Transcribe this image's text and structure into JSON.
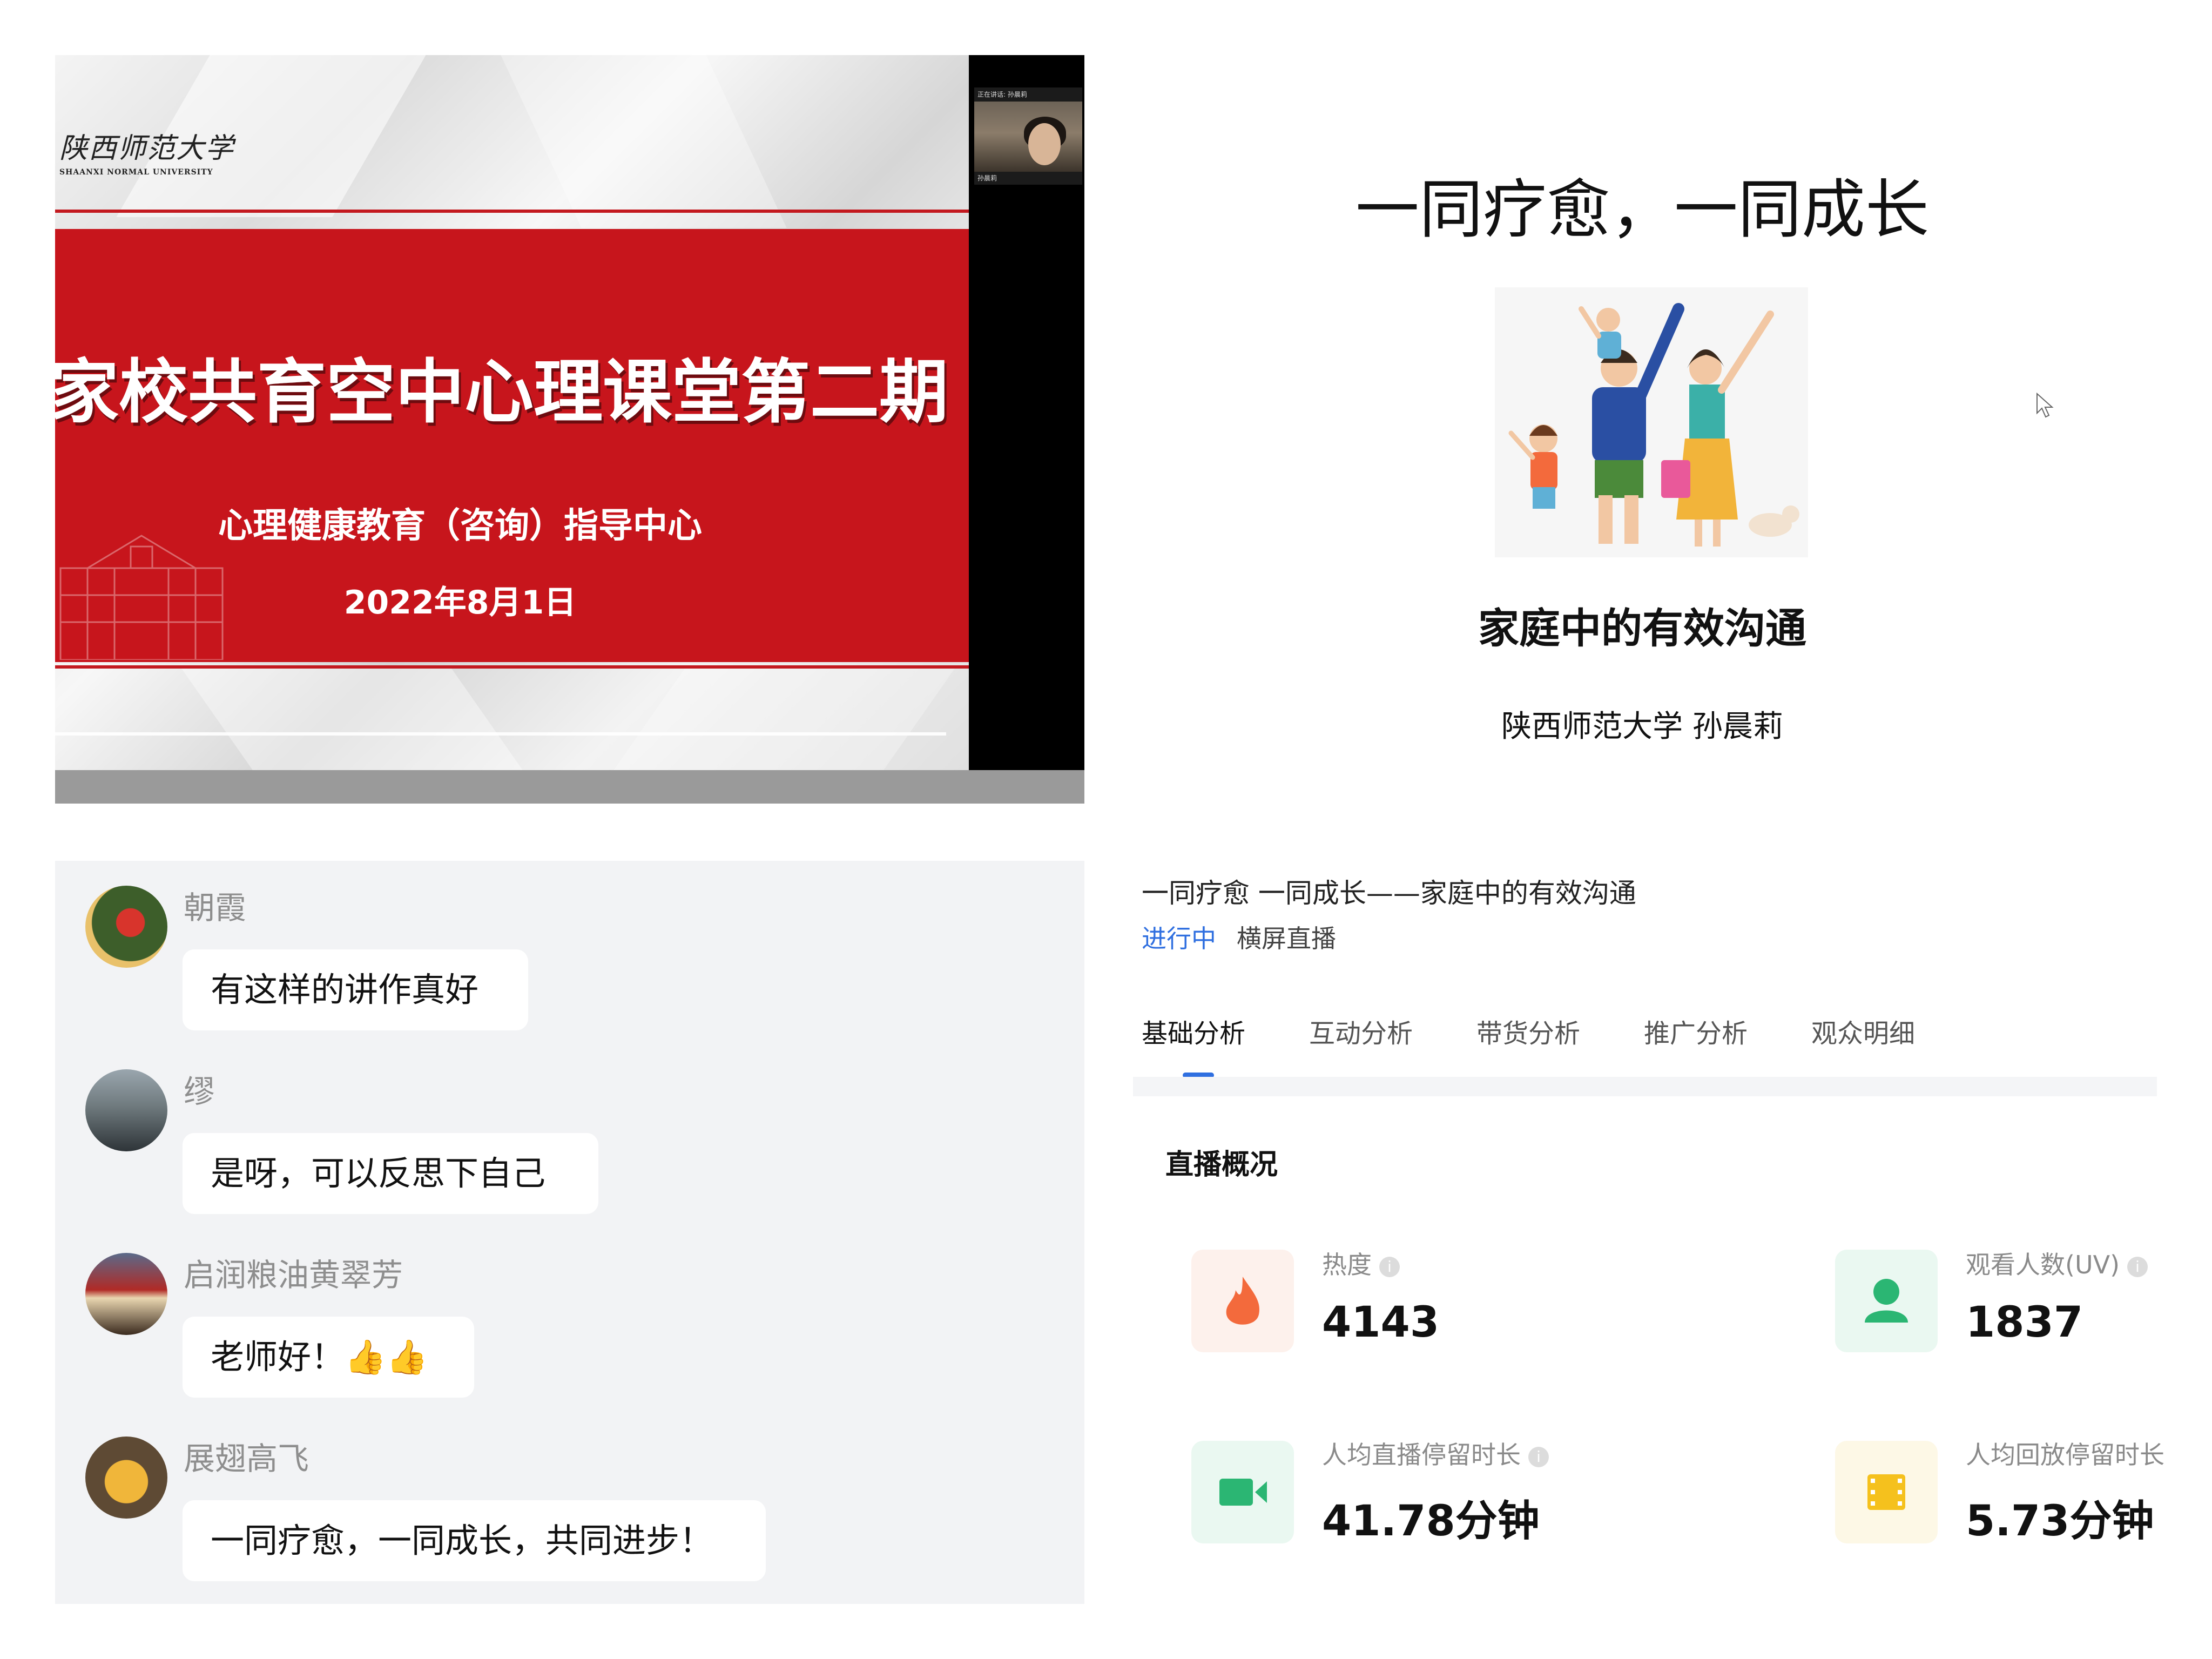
{
  "slide_left": {
    "logo_cn": "陕西师范大学",
    "logo_en": "SHAANXI NORMAL UNIVERSITY",
    "title": "家校共育空中心理课堂第二期",
    "subtitle": "心理健康教育（咨询）指导中心",
    "date": "2022年8月1日",
    "cam_top": "正在讲话: 孙晨莉",
    "cam_name": "孙晨莉"
  },
  "slide_cover": {
    "title": "一同疗愈，一同成长",
    "subtitle": "家庭中的有效沟通",
    "author": "陕西师范大学  孙晨莉"
  },
  "chat": {
    "messages": [
      {
        "name": "朝霞",
        "text": "有这样的讲作真好"
      },
      {
        "name": "缪",
        "text": "是呀，可以反思下自己"
      },
      {
        "name": "启润粮油黄翠芳",
        "text": "老师好！👍👍"
      },
      {
        "name": "展翅高飞",
        "text": "一同疗愈，一同成长，共同进步！"
      }
    ]
  },
  "live": {
    "title": "一同疗愈 一同成长——家庭中的有效沟通",
    "status": "进行中",
    "mode": "横屏直播",
    "tabs": [
      "基础分析",
      "互动分析",
      "带货分析",
      "推广分析",
      "观众明细"
    ],
    "section": "直播概况",
    "info_glyph": "i",
    "metrics": [
      {
        "label": "热度",
        "value": "4143",
        "icon": "flame-icon",
        "color": "#f36a3c",
        "bg": "#fdf1ec"
      },
      {
        "label": "观看人数(UV)",
        "value": "1837",
        "icon": "user-icon",
        "color": "#2bb673",
        "bg": "#eaf8f1"
      },
      {
        "label": "人均直播停留时长",
        "value": "41.78分钟",
        "icon": "video-camera-icon",
        "color": "#2bb673",
        "bg": "#eaf8f1"
      },
      {
        "label": "人均回放停留时长",
        "value": "5.73分钟",
        "icon": "film-icon",
        "color": "#f5c11d",
        "bg": "#fdf8e6"
      }
    ]
  }
}
